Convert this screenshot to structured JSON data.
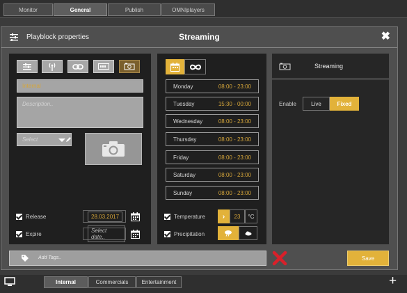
{
  "top_tabs": [
    "Monitor",
    "General",
    "Publish",
    "OMNIplayers"
  ],
  "active_top_tab": "General",
  "modal": {
    "title_left": "Playblock properties",
    "title_center": "Streaming",
    "close_label": "✖"
  },
  "left_panel": {
    "name_value": "Internal",
    "description_placeholder": "Description..",
    "select_placeholder": "Select",
    "release_label": "Release",
    "release_date": "28.03.2017",
    "expire_label": "Expire",
    "expire_placeholder": "Select date.."
  },
  "schedule": {
    "days": [
      {
        "day": "Monday",
        "time": "08:00 - 23:00"
      },
      {
        "day": "Tuesday",
        "time": "15:30 - 00:00"
      },
      {
        "day": "Wednesday",
        "time": "08:00 - 23:00"
      },
      {
        "day": "Thursday",
        "time": "08:00 - 23:00"
      },
      {
        "day": "Friday",
        "time": "08:00 - 23:00"
      },
      {
        "day": "Saturday",
        "time": "08:00 - 23:00"
      },
      {
        "day": "Sunday",
        "time": "08:00 - 23:00"
      }
    ],
    "temperature_label": "Temperature",
    "temperature_value": "23",
    "temperature_unit": "°C",
    "precipitation_label": "Precipitation"
  },
  "streaming_panel": {
    "title": "Streaming",
    "enable_label": "Enable",
    "option_live": "Live",
    "option_fixed": "Fixed",
    "selected": "Fixed"
  },
  "footer": {
    "tags_placeholder": "Add Tags..",
    "save_label": "Save"
  },
  "bottom_tabs": [
    "Internal",
    "Commercials",
    "Entertainment"
  ],
  "active_bottom_tab": "Internal",
  "colors": {
    "accent": "#e2b23a",
    "panel": "#1f1f1f",
    "modal": "#4f4f4f",
    "cancel": "#d9202a"
  }
}
